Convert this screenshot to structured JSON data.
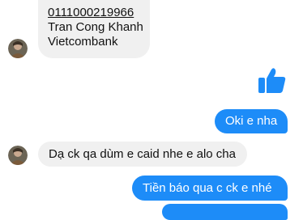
{
  "messages": [
    {
      "lines": [
        "0111000219966",
        "Tran Cong Khanh",
        "Vietcombank"
      ]
    },
    {
      "text": "Oki e nha"
    },
    {
      "text": "Dạ ck qa dùm e caid nhe e alo cha"
    },
    {
      "text": "Tiền báo qua c ck e nhé"
    }
  ],
  "icons": {
    "like": "thumbs-up-icon",
    "avatar": "avatar"
  },
  "colors": {
    "outgoing": "#1d8cf8",
    "incoming": "#f0f0f0",
    "like": "#1d8cf8"
  }
}
